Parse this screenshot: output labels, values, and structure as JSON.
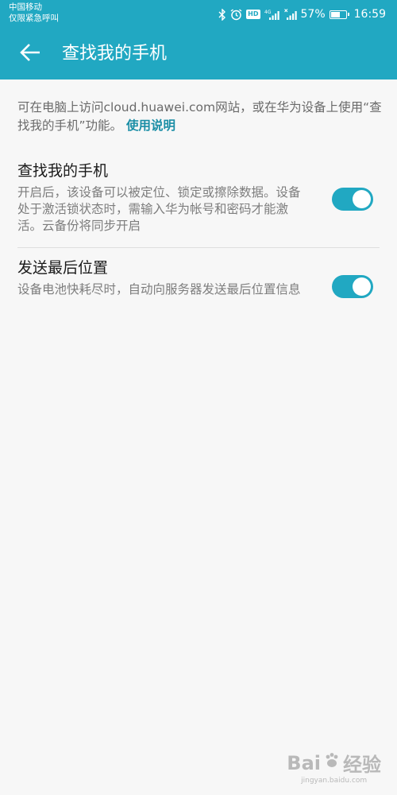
{
  "status_bar": {
    "carrier_line1": "中国移动",
    "carrier_line2": "仅限紧急呼叫",
    "hd": "HD",
    "signal_tag": "4G",
    "battery_percent": "57%",
    "battery_level": 0.57,
    "time": "16:59",
    "icons": [
      "bluetooth-icon",
      "alarm-icon",
      "hd-icon",
      "signal-icon",
      "no-sim-signal-icon",
      "battery-icon"
    ]
  },
  "app_bar": {
    "back_icon": "back-arrow-icon",
    "title": "查找我的手机",
    "color": "#21a8c2"
  },
  "intro": {
    "text": "可在电脑上访问cloud.huawei.com网站，或在华为设备上使用“查找我的手机”功能。",
    "link": "使用说明"
  },
  "settings": [
    {
      "title": "查找我的手机",
      "description": "开启后，该设备可以被定位、锁定或擦除数据。设备处于激活锁状态时，需输入华为帐号和密码才能激活。云备份将同步开启",
      "enabled": true
    },
    {
      "title": "发送最后位置",
      "description": "设备电池快耗尽时，自动向服务器发送最后位置信息",
      "enabled": true
    }
  ],
  "watermark": {
    "text_left": "Bai",
    "text_right": "经验",
    "url": "jingyan.baidu.com"
  }
}
